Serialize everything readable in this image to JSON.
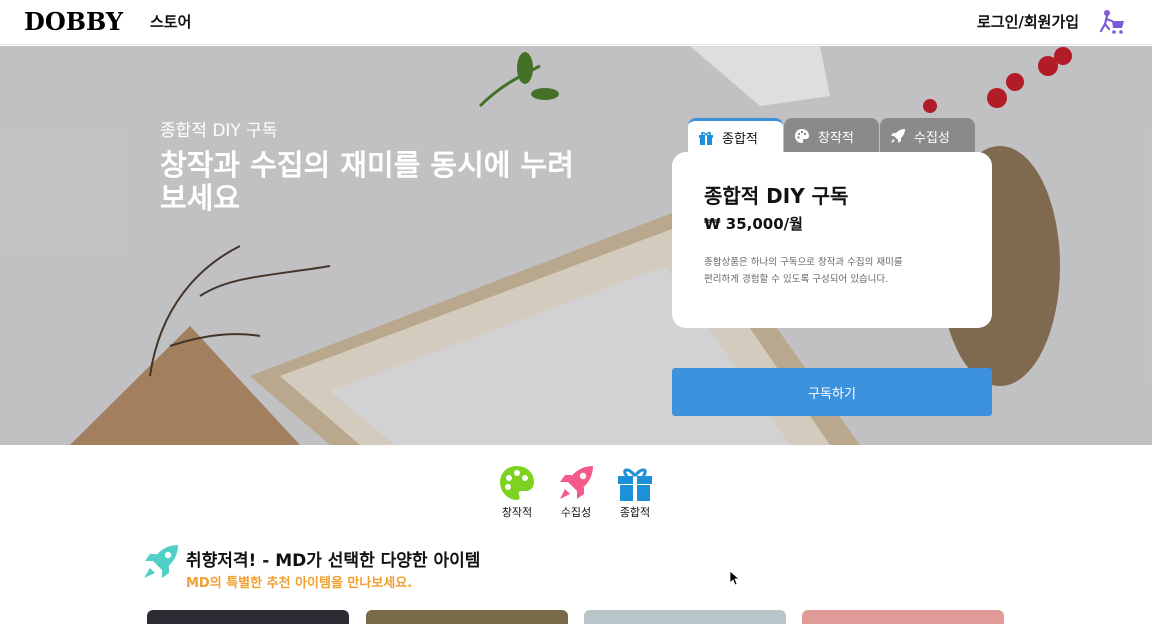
{
  "header": {
    "logo": "DOBBY",
    "store": "스토어",
    "login": "로그인/회원가입"
  },
  "hero": {
    "subtitle": "종합적 DIY 구독",
    "title": "창작과 수집의 재미를 동시에 누려보세요"
  },
  "tabs": [
    {
      "label": "종합적",
      "icon": "gift-icon",
      "active": true
    },
    {
      "label": "창작적",
      "icon": "palette-icon",
      "active": false
    },
    {
      "label": "수집성",
      "icon": "rocket-icon",
      "active": false
    }
  ],
  "card": {
    "title": "종합적 DIY 구독",
    "price": "₩ 35,000/월",
    "description": "종합상품은 하나의 구독으로 창작과 수집의 재미를 편리하게 경험할 수 있도록 구성되어 있습니다."
  },
  "subscribe_label": "구독하기",
  "categories": [
    {
      "label": "창작적",
      "icon": "palette-icon",
      "color": "#7ed321"
    },
    {
      "label": "수집성",
      "icon": "rocket-icon",
      "color": "#f45b8b"
    },
    {
      "label": "종합적",
      "icon": "gift-icon",
      "color": "#1e90d8"
    }
  ],
  "section": {
    "title": "취향저격! - MD가 선택한 다양한 아이템",
    "subtitle": "MD의 특별한 추천 아이템을 만나보세요.",
    "icon": "rocket-icon",
    "icon_color": "#4fd1c5"
  },
  "colors": {
    "accent": "#3d92de",
    "highlight": "#f0a030"
  }
}
